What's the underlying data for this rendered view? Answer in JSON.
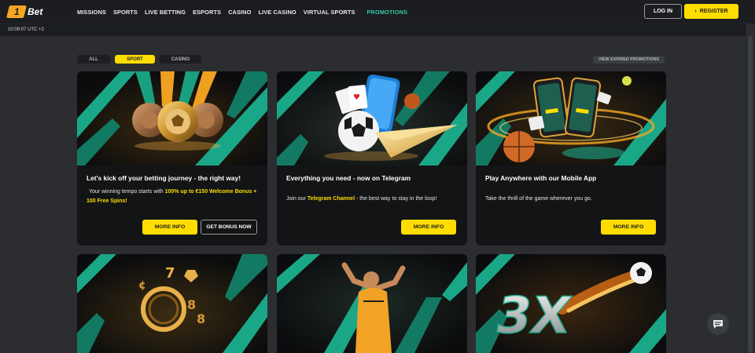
{
  "brand": {
    "logo_mark": "1",
    "logo_text": "Bet"
  },
  "nav": {
    "items": [
      {
        "label": "MISSIONS"
      },
      {
        "label": "SPORTS"
      },
      {
        "label": "LIVE BETTING"
      },
      {
        "label": "ESPORTS"
      },
      {
        "label": "CASINO"
      },
      {
        "label": "LIVE CASINO"
      },
      {
        "label": "VIRTUAL SPORTS"
      },
      {
        "label": "PROMOTIONS"
      }
    ],
    "active": "PROMOTIONS"
  },
  "auth": {
    "login_label": "LOG IN",
    "register_label": "REGISTER",
    "register_icon": "chevron-right-icon"
  },
  "status": {
    "clock": "10:09:07 UTC +2"
  },
  "filters": {
    "all": "ALL",
    "sport": "SPORT",
    "casino": "CASINO",
    "selected": "SPORT"
  },
  "expired_label": "VIEW EXPIRED PROMOTIONS",
  "cards": [
    {
      "title": "Let's kick off your betting journey - the right way!",
      "desc_pre": "Your winning tempo starts with ",
      "desc_hl": "100% up to €150 Welcome Bonus + 100 Free Spins!",
      "more_label": "MORE INFO",
      "bonus_label": "GET BONUS NOW"
    },
    {
      "title": "Everything you need - now on Telegram",
      "desc_pre": "Join our ",
      "desc_hl": "Telegram Channel",
      "desc_post": " - the best way to stay in the loop!",
      "more_label": "MORE INFO"
    },
    {
      "title": "Play Anywhere with our Mobile App",
      "desc_pre": "Take the thrill of the game wherever you go.",
      "more_label": "MORE INFO"
    }
  ],
  "bottom_cards": {
    "third_card_text": "3X"
  },
  "colors": {
    "accent_yellow": "#ffdd00",
    "accent_teal": "#35c6a5",
    "background": "#2b2d30",
    "topbar": "#1b1d20",
    "card": "#121416"
  },
  "icons": {
    "chat": "chat-bubble-icon"
  }
}
